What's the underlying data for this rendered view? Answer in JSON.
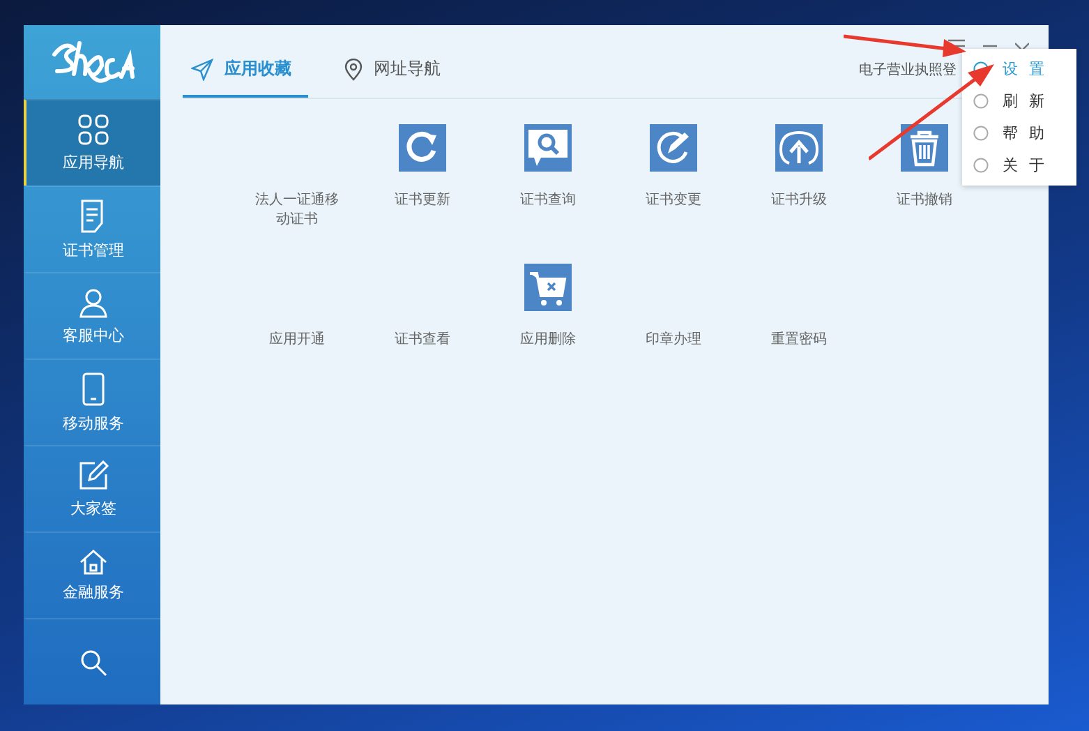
{
  "sidebar": {
    "items": [
      {
        "label": "应用导航",
        "kind": "grid",
        "selected": true
      },
      {
        "label": "证书管理",
        "kind": "document",
        "selected": false
      },
      {
        "label": "客服中心",
        "kind": "person",
        "selected": false
      },
      {
        "label": "移动服务",
        "kind": "phone",
        "selected": false
      },
      {
        "label": "大家签",
        "kind": "edit",
        "selected": false
      },
      {
        "label": "金融服务",
        "kind": "home",
        "selected": false
      },
      {
        "kind": "search",
        "selected": false
      }
    ]
  },
  "tabs": [
    {
      "label": "应用收藏",
      "kind": "send",
      "selected": true
    },
    {
      "label": "网址导航",
      "kind": "pin",
      "selected": false
    }
  ],
  "header_text": "电子营业执照登",
  "apps": [
    {
      "label": "法人一证通移动证书"
    },
    {
      "label": "证书更新",
      "kind": "refresh"
    },
    {
      "label": "证书查询",
      "kind": "search"
    },
    {
      "label": "证书变更",
      "kind": "change"
    },
    {
      "label": "证书升级",
      "kind": "upgrade"
    },
    {
      "label": "证书撤销",
      "kind": "trash"
    },
    {
      "label": "应用开通"
    },
    {
      "label": "证书查看"
    },
    {
      "label": "应用删除",
      "kind": "cart"
    },
    {
      "label": "印章办理"
    },
    {
      "label": "重置密码"
    }
  ],
  "menu": [
    {
      "label": "设置",
      "selected": true
    },
    {
      "label": "刷新",
      "selected": false
    },
    {
      "label": "帮助",
      "selected": false
    },
    {
      "label": "关于",
      "selected": false
    }
  ]
}
